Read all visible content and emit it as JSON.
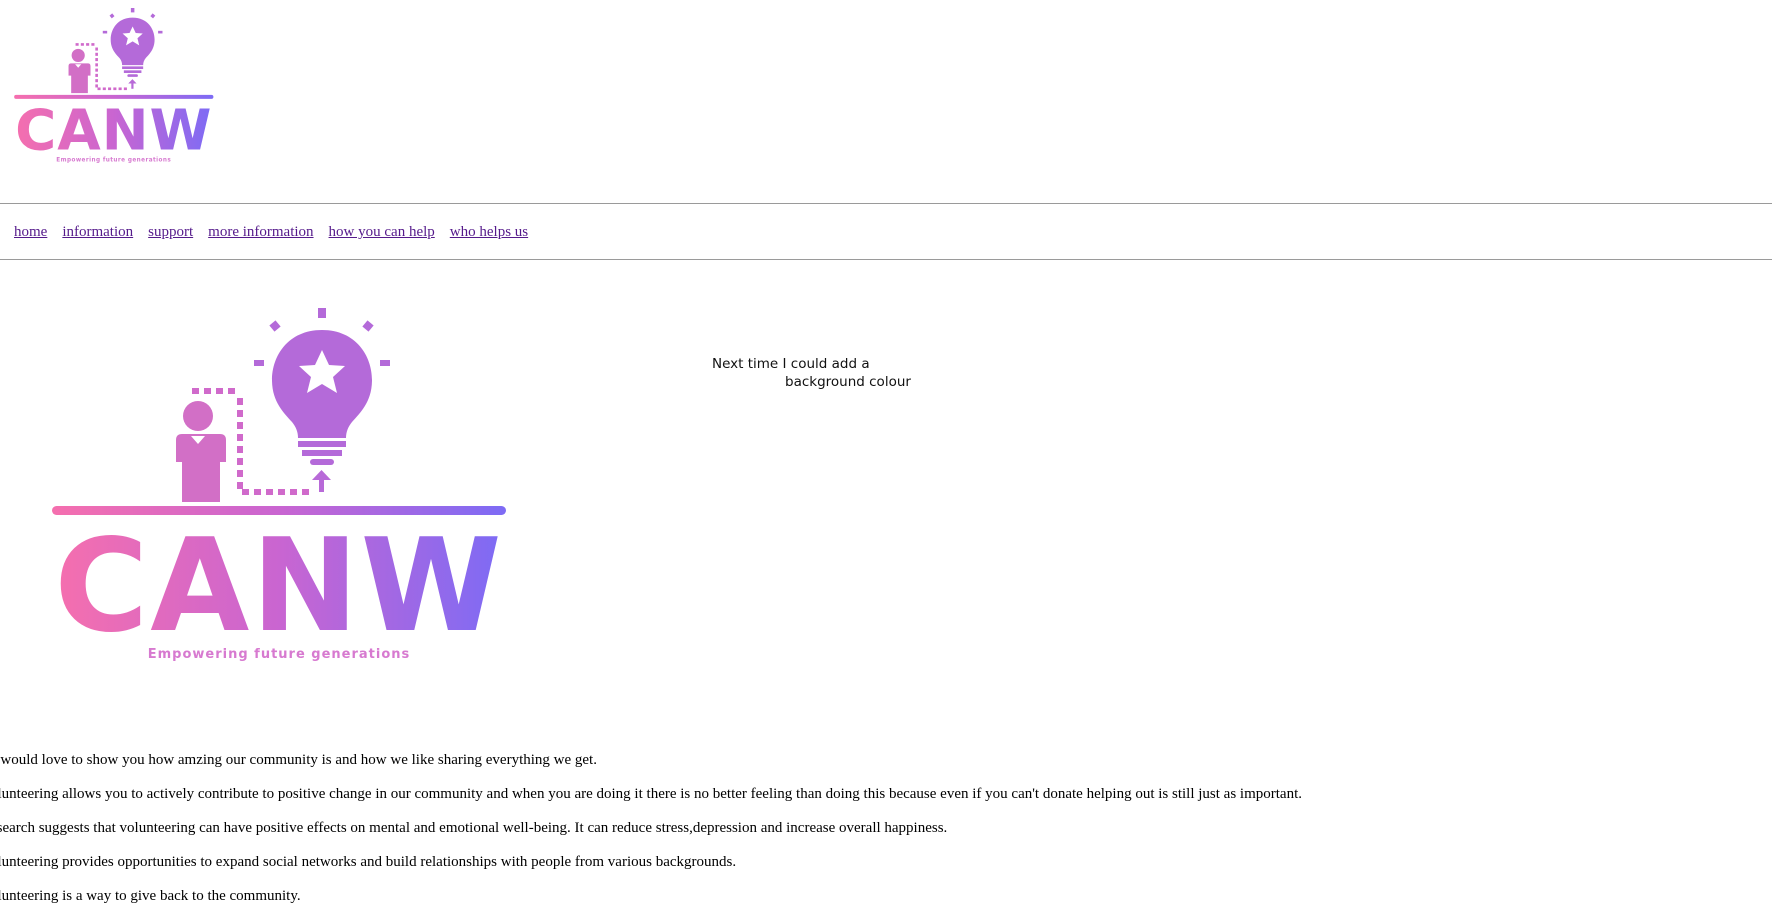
{
  "brand": {
    "name": "CANW",
    "tagline": "Empowering future generations",
    "gradient_start": "#f56fae",
    "gradient_mid": "#c965d1",
    "gradient_end": "#7d6bf5",
    "icon_names": [
      "person-icon",
      "lightbulb-star-icon",
      "arrow-up-icon"
    ]
  },
  "nav": {
    "items": [
      {
        "label": "home"
      },
      {
        "label": "information"
      },
      {
        "label": "support"
      },
      {
        "label": "more information"
      },
      {
        "label": "how you can help"
      },
      {
        "label": "who helps us"
      }
    ],
    "link_color": "#551a8b"
  },
  "note": {
    "line1": "Next time I could add a",
    "line2": "background colour"
  },
  "paragraphs": [
    "e would love to show you how amzing our community is and how we like sharing everything we get.",
    "olunteering allows you to actively contribute to positive change in our community and when you are doing it there is no better feeling than doing this because even if you can't donate helping out is still just as important.",
    "esearch suggests that volunteering can have positive effects on mental and emotional well-being. It can reduce stress,depression and increase overall happiness.",
    "olunteering provides opportunities to expand social networks and build relationships with people from various backgrounds.",
    "olunteering is a way to give back to the community."
  ]
}
